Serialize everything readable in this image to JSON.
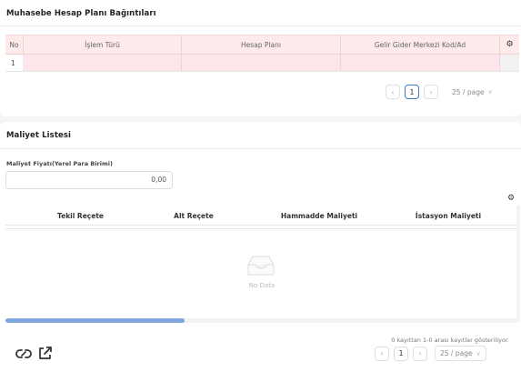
{
  "section1": {
    "title": "Muhasebe Hesap Planı Bağıntıları",
    "columns": [
      "No",
      "İşlem Türü",
      "Hesap Planı",
      "Gelir Gider Merkezi Kod/Ad"
    ],
    "rows": [
      {
        "no": "1"
      }
    ],
    "settings_icon": "gear-icon",
    "pagination": {
      "prev_icon": "chevron-left-icon",
      "current_page": "1",
      "next_icon": "chevron-right-icon",
      "page_size": "25 / page"
    }
  },
  "section2": {
    "title": "Maliyet Listesi",
    "cost_field": {
      "label": "Maliyet Fiyatı(Yerel Para Birimi)",
      "value": "0,00"
    },
    "settings_icon": "gear-icon",
    "columns": [
      "Tekil Reçete",
      "Alt Reçete",
      "Hammadde Maliyeti",
      "İstasyon Maliyeti"
    ],
    "empty_text": "No Data",
    "info": "0 kayıttan 1-0 arası kayıtlar gösteriliyor.",
    "pagination": {
      "current_page": "1",
      "page_size": "25 / page"
    },
    "footer_icons": [
      "link-icon",
      "external-link-icon"
    ]
  },
  "colors": {
    "header_pink": "#fdeaea",
    "row_pink": "#fce6ea",
    "accent_blue": "#3a7bd5",
    "scroll_blue": "#7fa7de"
  }
}
